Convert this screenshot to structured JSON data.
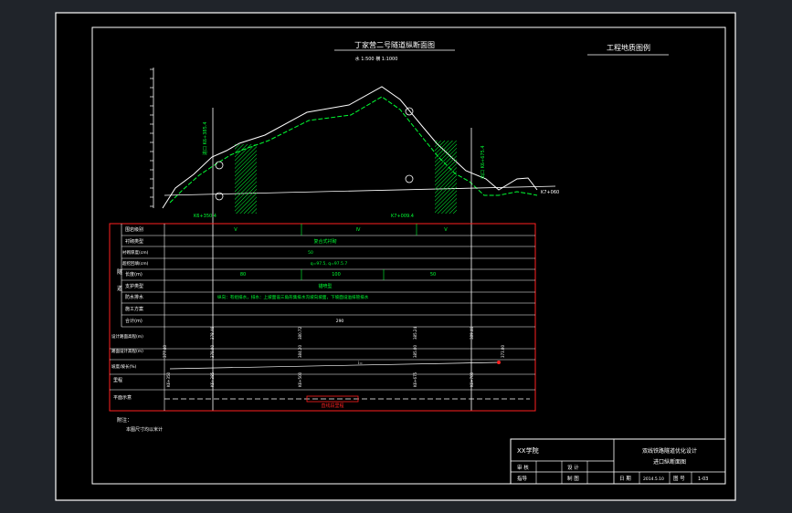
{
  "drawing": {
    "title": "丁家营二号隧道纵断面图",
    "scale_text": "水 1:500   横 1:1000",
    "legend_title": "工程地质图例",
    "note_label": "附注：",
    "note_text": "本图尺寸均以米计",
    "left_label_lower": "K6+350.4",
    "right_label_lower": "K7+009.4",
    "portal_left": "进口 K6+385.4",
    "portal_right": "出口 K6+675.4",
    "right_small": "K7+060",
    "rock_grades": [
      "V",
      "IV",
      "V"
    ],
    "lining_type": "复合式衬砌",
    "lining_value": "50",
    "grade_formula": "q=97.5, q=97.5.7",
    "lengths": [
      "80",
      "100",
      "50"
    ],
    "support_type": "锚喷型",
    "drainage_text": "纵向：有组排水，排水：上坡面设三角形集排水沟坡向坡面，下坡面设溢排管排水",
    "total_length": "290",
    "alignment_text": "直线段里程",
    "elev_values": [
      "378.46",
      "380.72",
      "385.24",
      "389.46"
    ],
    "design_elev": [
      "377.40",
      "379.00",
      "384.20",
      "385.00",
      "373.00"
    ],
    "slope_label": "i=",
    "station_values": [
      "K6+350",
      "K6+385",
      "K6+500",
      "K6+675",
      "K6+700"
    ]
  },
  "row_labels": [
    "围岩级别",
    "衬砌类型",
    "衬砌厚度(cm)",
    "超挖回填(cm)",
    "长度(m)",
    "支护类型",
    "防水排水",
    "施工方案",
    "合计(m)",
    "设计路面高程(m)",
    "路面设计高程(m)",
    "坡度/坡长(%)",
    "里程",
    "平面示意"
  ],
  "title_block": {
    "school": "XX学院",
    "project": "双线铁路隧道优化设计",
    "drawing_name": "进口纵断面图",
    "cell_review": "审 核",
    "cell_design": "设 计",
    "cell_advisor": "指导",
    "cell_draw": "制 图",
    "cell_date": "日 期",
    "date_value": "2014.5.10",
    "cell_number": "图 号",
    "number_value": "1-03"
  },
  "colors": {
    "background": "#000000",
    "frame": "#ffffff",
    "terrain": "#ffffff",
    "design_line": "#00ff33",
    "table_border": "#ff2020",
    "label_red": "#ff2020"
  }
}
